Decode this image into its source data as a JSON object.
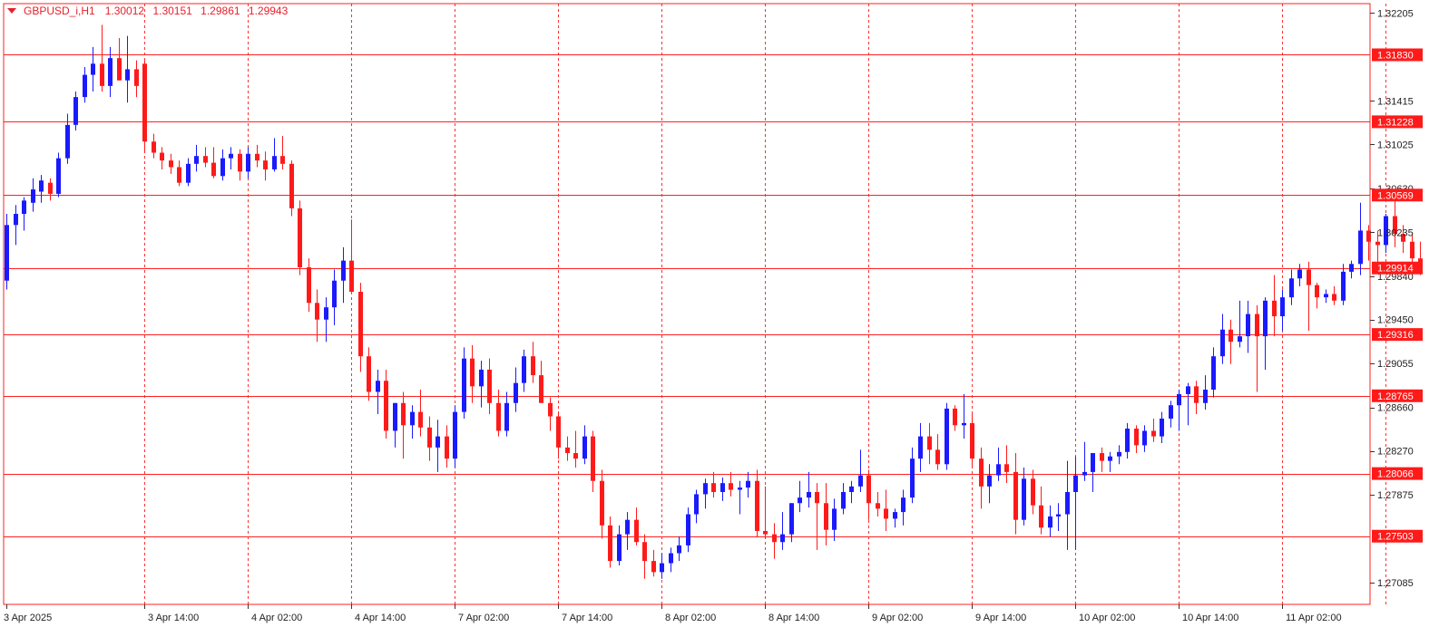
{
  "header": {
    "symbol": "GBPUSD_i,H1",
    "open": "1.30012",
    "high": "1.30151",
    "low": "1.29861",
    "close": "1.29943"
  },
  "colors": {
    "bull": "#1a1aff",
    "bear": "#ff1a1a",
    "level_line": "#ff2020",
    "grid": "#ff3030",
    "axis_text": "#222222",
    "label_bg": "#ff1a1a",
    "label_text": "#ffffff",
    "doji": "#22cc22"
  },
  "chart_data": {
    "type": "candlestick",
    "title": "GBPUSD_i,H1",
    "ylim": [
      1.2689,
      1.3229
    ],
    "x_ticks": [
      "3 Apr 2025",
      "3 Apr 14:00",
      "4 Apr 02:00",
      "4 Apr 14:00",
      "7 Apr 02:00",
      "7 Apr 14:00",
      "8 Apr 02:00",
      "8 Apr 14:00",
      "9 Apr 02:00",
      "9 Apr 14:00",
      "10 Apr 02:00",
      "10 Apr 14:00",
      "11 Apr 02:00"
    ],
    "x_tick_index": [
      0,
      16,
      28,
      40,
      52,
      64,
      76,
      88,
      100,
      112,
      124,
      136,
      148
    ],
    "y_ticks": [
      "1.32205",
      "1.31415",
      "1.31025",
      "1.30630",
      "1.30235",
      "1.29840",
      "1.29450",
      "1.29055",
      "1.28660",
      "1.28270",
      "1.27875",
      "1.27085"
    ],
    "levels": [
      "1.31830",
      "1.31228",
      "1.30569",
      "1.29914",
      "1.29316",
      "1.28765",
      "1.28066",
      "1.27503"
    ],
    "candles": [
      [
        1.298,
        1.304,
        1.2972,
        1.303
      ],
      [
        1.303,
        1.3048,
        1.3012,
        1.304
      ],
      [
        1.304,
        1.3055,
        1.3025,
        1.3052
      ],
      [
        1.305,
        1.3072,
        1.3042,
        1.3062
      ],
      [
        1.306,
        1.3075,
        1.305,
        1.307
      ],
      [
        1.3068,
        1.3072,
        1.3052,
        1.3058
      ],
      [
        1.3058,
        1.3095,
        1.3055,
        1.309
      ],
      [
        1.309,
        1.313,
        1.3085,
        1.312
      ],
      [
        1.312,
        1.315,
        1.3115,
        1.3145
      ],
      [
        1.3145,
        1.3172,
        1.314,
        1.3165
      ],
      [
        1.3165,
        1.319,
        1.315,
        1.3175
      ],
      [
        1.3175,
        1.321,
        1.315,
        1.3155
      ],
      [
        1.3155,
        1.319,
        1.3145,
        1.318
      ],
      [
        1.318,
        1.3198,
        1.316,
        1.316
      ],
      [
        1.316,
        1.32,
        1.314,
        1.317
      ],
      [
        1.317,
        1.3178,
        1.3145,
        1.3155
      ],
      [
        1.3175,
        1.3178,
        1.3095,
        1.3105
      ],
      [
        1.3105,
        1.3112,
        1.309,
        1.3095
      ],
      [
        1.3095,
        1.31,
        1.308,
        1.3088
      ],
      [
        1.3088,
        1.3094,
        1.3076,
        1.3082
      ],
      [
        1.3082,
        1.3088,
        1.3065,
        1.3068
      ],
      [
        1.3068,
        1.309,
        1.3065,
        1.3085
      ],
      [
        1.3085,
        1.3102,
        1.3078,
        1.3092
      ],
      [
        1.3092,
        1.31,
        1.3082,
        1.3086
      ],
      [
        1.3086,
        1.31,
        1.3072,
        1.3074
      ],
      [
        1.3074,
        1.3098,
        1.307,
        1.309
      ],
      [
        1.309,
        1.31,
        1.308,
        1.3094
      ],
      [
        1.3094,
        1.3098,
        1.307,
        1.3078
      ],
      [
        1.3078,
        1.31,
        1.3072,
        1.3094
      ],
      [
        1.3094,
        1.3102,
        1.3082,
        1.3088
      ],
      [
        1.3088,
        1.3096,
        1.307,
        1.308
      ],
      [
        1.308,
        1.3108,
        1.3078,
        1.3092
      ],
      [
        1.3092,
        1.311,
        1.308,
        1.3085
      ],
      [
        1.3085,
        1.3088,
        1.3038,
        1.3045
      ],
      [
        1.3045,
        1.3052,
        1.2985,
        1.2992
      ],
      [
        1.2992,
        1.3,
        1.2952,
        1.296
      ],
      [
        1.296,
        1.2972,
        1.2925,
        1.2945
      ],
      [
        1.2945,
        1.2965,
        1.2925,
        1.2956
      ],
      [
        1.2956,
        1.299,
        1.294,
        1.298
      ],
      [
        1.298,
        1.301,
        1.296,
        1.2998
      ],
      [
        1.2998,
        1.3035,
        1.2975,
        1.297
      ],
      [
        1.297,
        1.2978,
        1.2898,
        1.2912
      ],
      [
        1.2912,
        1.292,
        1.2872,
        1.288
      ],
      [
        1.288,
        1.29,
        1.286,
        1.289
      ],
      [
        1.289,
        1.29,
        1.2838,
        1.2845
      ],
      [
        1.2845,
        1.287,
        1.283,
        1.287
      ],
      [
        1.287,
        1.288,
        1.282,
        1.285
      ],
      [
        1.285,
        1.2868,
        1.2838,
        1.2862
      ],
      [
        1.2862,
        1.2882,
        1.284,
        1.2848
      ],
      [
        1.2848,
        1.2858,
        1.2818,
        1.283
      ],
      [
        1.283,
        1.2855,
        1.2808,
        1.284
      ],
      [
        1.284,
        1.285,
        1.2812,
        1.282
      ],
      [
        1.282,
        1.2868,
        1.2812,
        1.2862
      ],
      [
        1.2862,
        1.292,
        1.2856,
        1.291
      ],
      [
        1.291,
        1.2922,
        1.287,
        1.2885
      ],
      [
        1.2885,
        1.2908,
        1.2866,
        1.29
      ],
      [
        1.29,
        1.291,
        1.286,
        1.287
      ],
      [
        1.287,
        1.2882,
        1.284,
        1.2845
      ],
      [
        1.2845,
        1.288,
        1.284,
        1.287
      ],
      [
        1.287,
        1.2902,
        1.2862,
        1.2888
      ],
      [
        1.2888,
        1.2918,
        1.288,
        1.2912
      ],
      [
        1.2912,
        1.2925,
        1.2888,
        1.2895
      ],
      [
        1.2895,
        1.2908,
        1.2872,
        1.287
      ],
      [
        1.287,
        1.2875,
        1.2845,
        1.2858
      ],
      [
        1.2858,
        1.2862,
        1.282,
        1.283
      ],
      [
        1.283,
        1.284,
        1.2818,
        1.2825
      ],
      [
        1.2825,
        1.2845,
        1.2812,
        1.282
      ],
      [
        1.282,
        1.285,
        1.2815,
        1.284
      ],
      [
        1.284,
        1.2845,
        1.279,
        1.28
      ],
      [
        1.28,
        1.281,
        1.2748,
        1.276
      ],
      [
        1.276,
        1.2768,
        1.2722,
        1.2728
      ],
      [
        1.2728,
        1.276,
        1.2724,
        1.2752
      ],
      [
        1.2752,
        1.2772,
        1.2738,
        1.2765
      ],
      [
        1.2765,
        1.2776,
        1.2742,
        1.2745
      ],
      [
        1.2745,
        1.2752,
        1.2712,
        1.2728
      ],
      [
        1.2728,
        1.2738,
        1.2714,
        1.2718
      ],
      [
        1.2718,
        1.2735,
        1.2712,
        1.2726
      ],
      [
        1.2726,
        1.274,
        1.2718,
        1.2735
      ],
      [
        1.2735,
        1.275,
        1.2728,
        1.2742
      ],
      [
        1.2742,
        1.2776,
        1.2736,
        1.277
      ],
      [
        1.277,
        1.2792,
        1.2762,
        1.2788
      ],
      [
        1.2788,
        1.2802,
        1.2775,
        1.2798
      ],
      [
        1.2798,
        1.2808,
        1.2785,
        1.279
      ],
      [
        1.279,
        1.2803,
        1.2782,
        1.2798
      ],
      [
        1.2798,
        1.2808,
        1.2786,
        1.2792
      ],
      [
        1.2792,
        1.28,
        1.277,
        1.2794
      ],
      [
        1.2794,
        1.2808,
        1.2785,
        1.28
      ],
      [
        1.28,
        1.281,
        1.275,
        1.2755
      ],
      [
        1.2755,
        1.2795,
        1.2748,
        1.2752
      ],
      [
        1.2752,
        1.2762,
        1.273,
        1.2745
      ],
      [
        1.2745,
        1.2772,
        1.2738,
        1.2752
      ],
      [
        1.2752,
        1.278,
        1.2745,
        1.278
      ],
      [
        1.278,
        1.28,
        1.2772,
        1.2785
      ],
      [
        1.2785,
        1.2808,
        1.2776,
        1.279
      ],
      [
        1.279,
        1.2798,
        1.2738,
        1.278
      ],
      [
        1.278,
        1.2798,
        1.2742,
        1.2756
      ],
      [
        1.2756,
        1.2784,
        1.2746,
        1.2775
      ],
      [
        1.2775,
        1.2798,
        1.277,
        1.279
      ],
      [
        1.279,
        1.28,
        1.278,
        1.2795
      ],
      [
        1.2795,
        1.2828,
        1.279,
        1.2805
      ],
      [
        1.2805,
        1.281,
        1.2765,
        1.278
      ],
      [
        1.278,
        1.279,
        1.2768,
        1.2775
      ],
      [
        1.2775,
        1.2792,
        1.2755,
        1.2766
      ],
      [
        1.2766,
        1.2775,
        1.2758,
        1.2772
      ],
      [
        1.2772,
        1.2792,
        1.276,
        1.2785
      ],
      [
        1.2785,
        1.283,
        1.278,
        1.282
      ],
      [
        1.282,
        1.2852,
        1.2808,
        1.284
      ],
      [
        1.284,
        1.2852,
        1.2815,
        1.2828
      ],
      [
        1.2828,
        1.2842,
        1.281,
        1.2815
      ],
      [
        1.2815,
        1.287,
        1.281,
        1.2865
      ],
      [
        1.2865,
        1.2868,
        1.2845,
        1.285
      ],
      [
        1.285,
        1.2878,
        1.2838,
        1.2852
      ],
      [
        1.2852,
        1.286,
        1.2812,
        1.282
      ],
      [
        1.282,
        1.283,
        1.2775,
        1.2795
      ],
      [
        1.2795,
        1.2815,
        1.278,
        1.2805
      ],
      [
        1.2805,
        1.283,
        1.28,
        1.2815
      ],
      [
        1.2815,
        1.2832,
        1.2798,
        1.2808
      ],
      [
        1.2808,
        1.2825,
        1.2752,
        1.2765
      ],
      [
        1.2765,
        1.2812,
        1.276,
        1.2802
      ],
      [
        1.2802,
        1.281,
        1.277,
        1.2778
      ],
      [
        1.2778,
        1.2795,
        1.2752,
        1.2758
      ],
      [
        1.2758,
        1.2778,
        1.275,
        1.2768
      ],
      [
        1.2768,
        1.278,
        1.2755,
        1.277
      ],
      [
        1.277,
        1.2818,
        1.2738,
        1.279
      ],
      [
        1.279,
        1.2822,
        1.2738,
        1.2805
      ],
      [
        1.2805,
        1.2835,
        1.28,
        1.2808
      ],
      [
        1.2808,
        1.2825,
        1.279,
        1.2825
      ],
      [
        1.2825,
        1.283,
        1.2808,
        1.2818
      ],
      [
        1.2818,
        1.2826,
        1.2808,
        1.2822
      ],
      [
        1.2822,
        1.2832,
        1.2815,
        1.2826
      ],
      [
        1.2826,
        1.2852,
        1.282,
        1.2847
      ],
      [
        1.2847,
        1.285,
        1.2825,
        1.2832
      ],
      [
        1.2832,
        1.285,
        1.2826,
        1.2845
      ],
      [
        1.2845,
        1.2856,
        1.2835,
        1.284
      ],
      [
        1.284,
        1.2862,
        1.2834,
        1.2856
      ],
      [
        1.2856,
        1.2872,
        1.2848,
        1.2868
      ],
      [
        1.2868,
        1.2882,
        1.2845,
        1.2878
      ],
      [
        1.2878,
        1.2888,
        1.285,
        1.2885
      ],
      [
        1.2885,
        1.289,
        1.286,
        1.287
      ],
      [
        1.287,
        1.2895,
        1.2864,
        1.2882
      ],
      [
        1.2882,
        1.292,
        1.2875,
        1.2912
      ],
      [
        1.2912,
        1.295,
        1.2905,
        1.2936
      ],
      [
        1.2936,
        1.2945,
        1.2905,
        1.2925
      ],
      [
        1.2925,
        1.2962,
        1.292,
        1.293
      ],
      [
        1.293,
        1.2962,
        1.2915,
        1.295
      ],
      [
        1.295,
        1.2958,
        1.288,
        1.293
      ],
      [
        1.293,
        1.2965,
        1.29,
        1.2962
      ],
      [
        1.2962,
        1.2985,
        1.293,
        1.2948
      ],
      [
        1.2948,
        1.2972,
        1.2935,
        1.2965
      ],
      [
        1.2965,
        1.299,
        1.2958,
        1.2982
      ],
      [
        1.2982,
        1.2995,
        1.2975,
        1.299
      ],
      [
        1.299,
        1.2997,
        1.2935,
        1.2976
      ],
      [
        1.2976,
        1.2978,
        1.2955,
        1.2965
      ],
      [
        1.2965,
        1.2972,
        1.296,
        1.2968
      ],
      [
        1.2968,
        1.2975,
        1.2958,
        1.2962
      ],
      [
        1.2962,
        1.2995,
        1.2958,
        1.2988
      ],
      [
        1.2988,
        1.2998,
        1.2982,
        1.2995
      ],
      [
        1.2995,
        1.305,
        1.2985,
        1.3025
      ],
      [
        1.3025,
        1.303,
        1.2998,
        1.3015
      ],
      [
        1.3015,
        1.3025,
        1.2995,
        1.3012
      ],
      [
        1.3012,
        1.304,
        1.3005,
        1.3038
      ],
      [
        1.3038,
        1.3052,
        1.301,
        1.3022
      ],
      [
        1.3022,
        1.303,
        1.3005,
        1.3015
      ],
      [
        1.3015,
        1.3022,
        1.2988,
        1.3
      ],
      [
        1.3,
        1.3015,
        1.2985,
        1.2994
      ]
    ]
  }
}
